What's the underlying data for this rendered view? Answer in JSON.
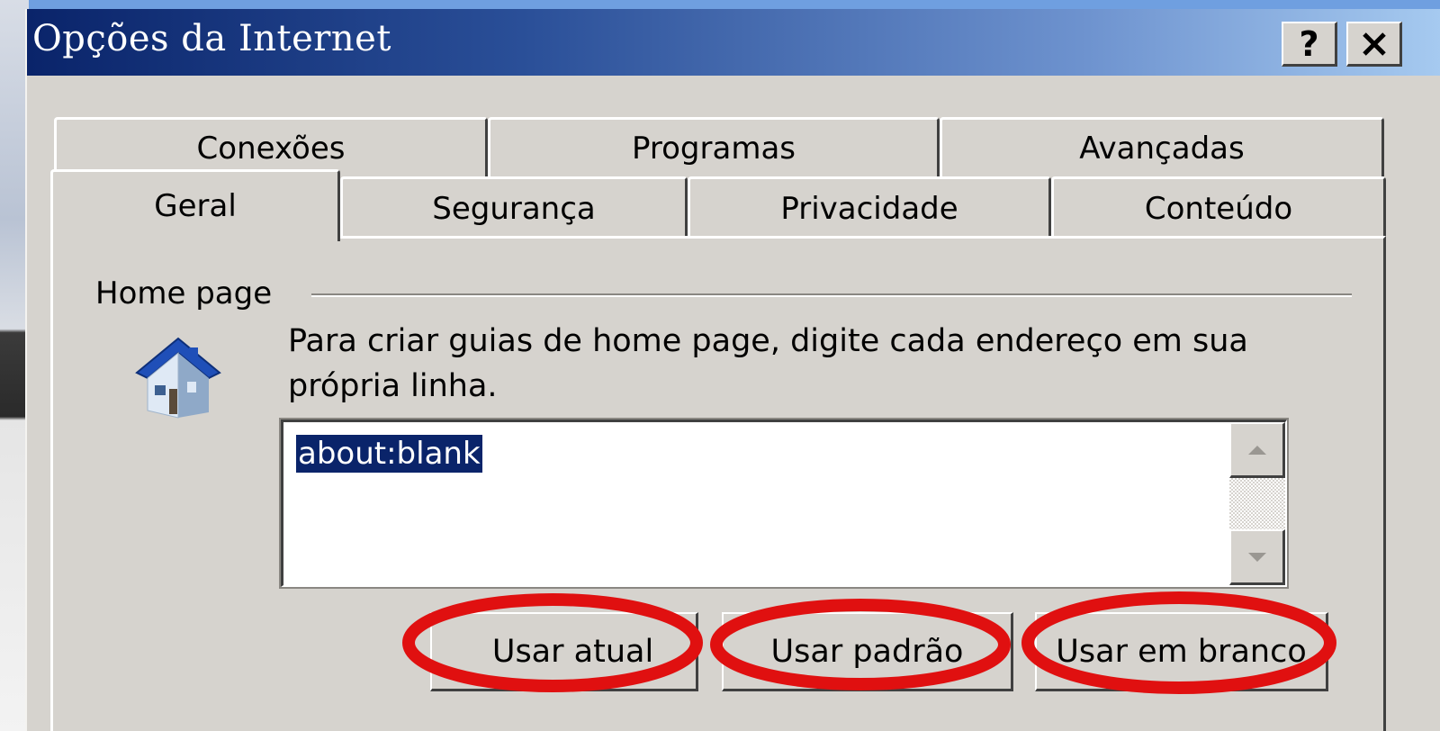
{
  "window": {
    "title": "Opções da Internet",
    "help_button": "?",
    "close_button": "✕"
  },
  "tabs": {
    "back_row": [
      "Conexões",
      "Programas",
      "Avançadas"
    ],
    "front_row": [
      "Geral",
      "Segurança",
      "Privacidade",
      "Conteúdo"
    ],
    "selected": "Geral"
  },
  "home_page": {
    "group_label": "Home page",
    "icon": "house-icon",
    "description": "Para criar guias de home page, digite cada endereço em sua própria linha.",
    "value": "about:blank",
    "buttons": {
      "use_current": "Usar atual",
      "use_default": "Usar padrão",
      "use_blank": "Usar em branco"
    }
  },
  "colors": {
    "dialog_bg": "#d6d3ce",
    "title_gradient_start": "#0a246a",
    "title_gradient_end": "#a6caf0",
    "selection": "#0a246a",
    "annotation_circle": "#e01010"
  }
}
